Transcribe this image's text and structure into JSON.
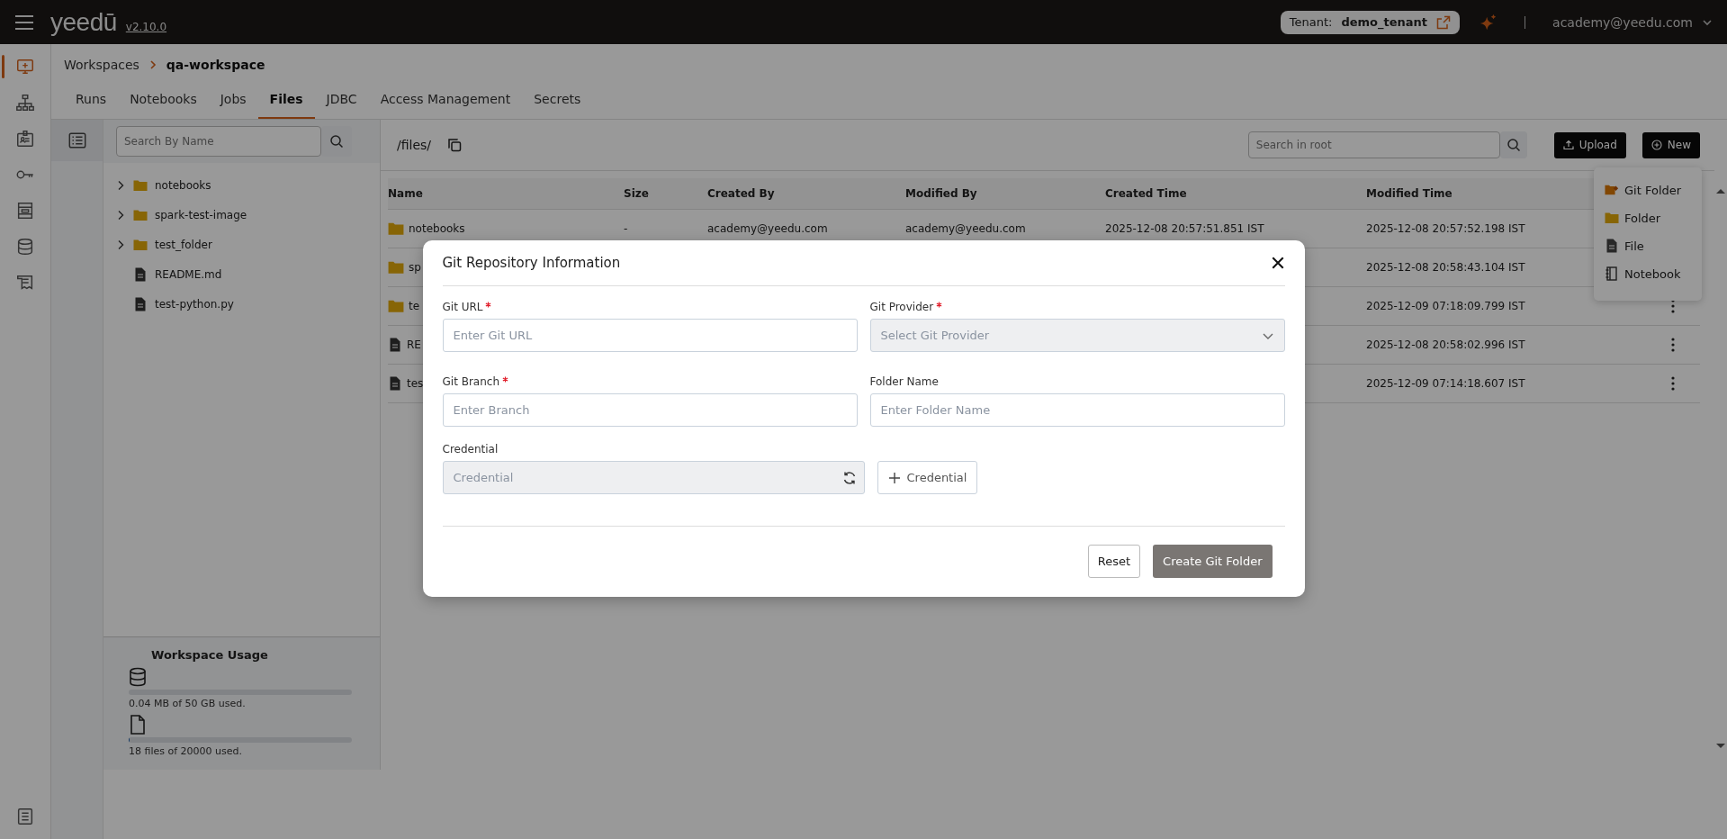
{
  "header": {
    "logo": "yeedū",
    "version": "v2.10.0",
    "tenant_label": "Tenant:",
    "tenant": "demo_tenant",
    "user": "academy@yeedu.com"
  },
  "rail": [
    {
      "kind": "workspace",
      "selected": true
    },
    {
      "kind": "cluster",
      "selected": false
    },
    {
      "kind": "profile",
      "selected": false
    },
    {
      "kind": "key",
      "selected": false
    },
    {
      "kind": "layout",
      "selected": false
    },
    {
      "kind": "database",
      "selected": false
    },
    {
      "kind": "notes",
      "selected": false
    }
  ],
  "breadcrumb": [
    "Workspaces",
    "qa-workspace"
  ],
  "tabs": [
    {
      "label": "Runs",
      "selected": false
    },
    {
      "label": "Notebooks",
      "selected": false
    },
    {
      "label": "Jobs",
      "selected": false
    },
    {
      "label": "Files",
      "selected": true
    },
    {
      "label": "JDBC",
      "selected": false
    },
    {
      "label": "Access Management",
      "selected": false
    },
    {
      "label": "Secrets",
      "selected": false
    }
  ],
  "tree": {
    "search_placeholder": "Search By Name",
    "items": [
      {
        "kind": "folder",
        "name": "notebooks",
        "expanded": false
      },
      {
        "kind": "folder",
        "name": "spark-test-image",
        "expanded": false
      },
      {
        "kind": "folder",
        "name": "test_folder",
        "expanded": false
      },
      {
        "kind": "file",
        "name": "README.md"
      },
      {
        "kind": "file",
        "name": "test-python.py"
      }
    ]
  },
  "usage": {
    "title": "Workspace Usage",
    "meters": [
      {
        "kind": "storage",
        "level": 0,
        "reading": "0.04 MB of 50 GB used."
      },
      {
        "kind": "files",
        "level": 0.005,
        "reading": "18 files of 20000 used."
      }
    ]
  },
  "files": {
    "path": "/files/",
    "search_placeholder": "Search in root",
    "upload": "Upload",
    "new": "New",
    "columns": [
      "Name",
      "Size",
      "Created By",
      "Modified By",
      "Created Time",
      "Modified Time"
    ],
    "rows": [
      {
        "kind": "folder",
        "covered": true,
        "name": "notebooks",
        "size": "-",
        "created_by": "academy@yeedu.com",
        "modified_by": "academy@yeedu.com",
        "created_time": "2025-12-08 20:57:51.851 IST",
        "modified_time": "2025-12-08 20:57:52.198 IST"
      },
      {
        "kind": "folder",
        "covered": true,
        "name": "sp",
        "modified_time": "2025-12-08 20:58:43.104 IST"
      },
      {
        "kind": "folder",
        "covered": false,
        "name": "te",
        "modified_time": "2025-12-09 07:18:09.799 IST"
      },
      {
        "kind": "file",
        "covered": false,
        "name": "RE",
        "modified_time": "2025-12-08 20:58:02.996 IST"
      },
      {
        "kind": "file",
        "covered": false,
        "name": "tes",
        "modified_time": "2025-12-09 07:14:18.607 IST"
      }
    ]
  },
  "new_menu": [
    {
      "kind": "git",
      "label": "Git Folder"
    },
    {
      "kind": "folder",
      "label": "Folder"
    },
    {
      "kind": "file",
      "label": "File"
    },
    {
      "kind": "notebook",
      "label": "Notebook"
    }
  ],
  "modal": {
    "title": "Git Repository Information",
    "fields": [
      {
        "kind": "input",
        "label": "Git URL",
        "required": true,
        "placeholder": "Enter Git URL",
        "disabled": false
      },
      {
        "kind": "select",
        "label": "Git Provider",
        "required": true,
        "placeholder": "Select Git Provider",
        "disabled": true
      },
      {
        "kind": "input",
        "label": "Git Branch",
        "required": true,
        "placeholder": "Enter Branch",
        "disabled": false
      },
      {
        "kind": "input",
        "label": "Folder Name",
        "required": false,
        "placeholder": "Enter Folder Name",
        "disabled": false
      }
    ],
    "credential": {
      "label": "Credential",
      "placeholder": "Credential",
      "disabled": true,
      "add_button": "Credential"
    },
    "buttons": {
      "reset": "Reset",
      "create": "Create Git Folder"
    }
  }
}
